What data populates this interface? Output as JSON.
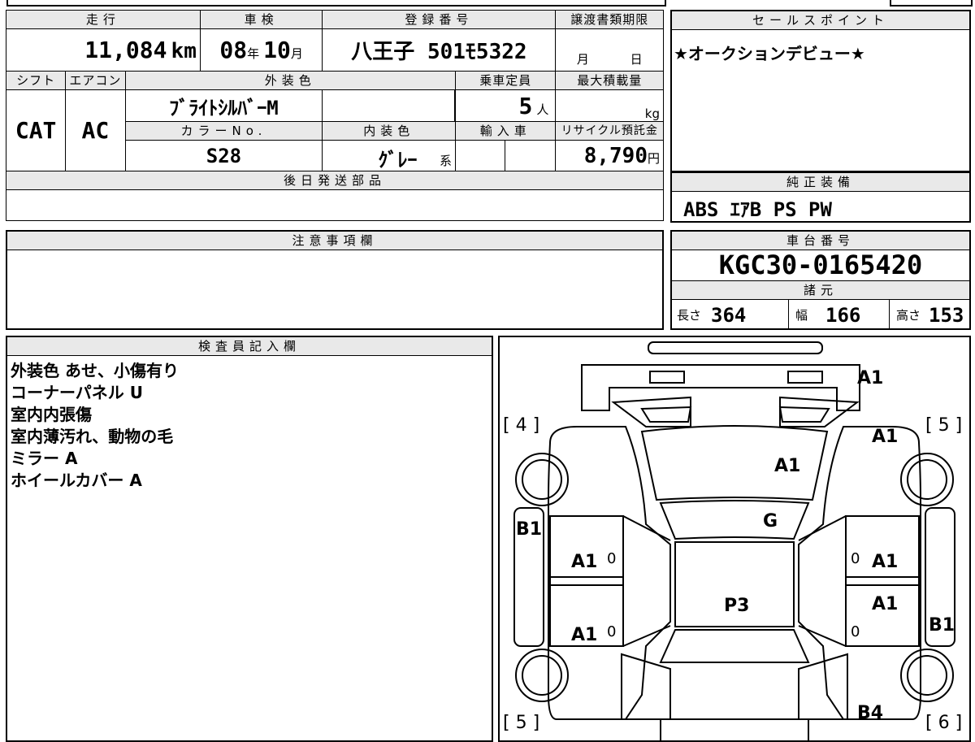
{
  "headers": {
    "mileage": "走行",
    "inspection": "車検",
    "registration": "登録番号",
    "transfer_deadline": "譲渡書類期限",
    "shift": "シフト",
    "aircon": "エアコン",
    "exterior_color": "外装色",
    "capacity": "乗車定員",
    "max_load": "最大積載量",
    "color_no": "カラーNo.",
    "interior_color": "内装色",
    "import_car": "輸入車",
    "recycle_fee": "リサイクル預託金",
    "later_parts": "後日発送部品",
    "sales_points": "セールスポイント",
    "genuine_equipment": "純正装備",
    "caution": "注意事項欄",
    "chassis_number": "車台番号",
    "specs": "諸元",
    "inspector": "検査員記入欄"
  },
  "vehicle": {
    "mileage_value": "11,084",
    "mileage_unit": "km",
    "inspection_year": "08",
    "year_unit": "年",
    "inspection_month": "10",
    "month_unit": "月",
    "registration_number": "八王子 501ﾓ5322",
    "deadline_month_unit": "月",
    "deadline_day_unit": "日",
    "shift": "CAT",
    "aircon": "AC",
    "exterior_color": "ﾌﾞﾗｲﾄｼﾙﾊﾞｰM",
    "capacity_value": "5",
    "capacity_unit": "人",
    "max_load_unit": "kg",
    "color_no": "S28",
    "interior_color": "ｸﾞﾚｰ",
    "interior_suffix": "系",
    "recycle_value": "8,790",
    "recycle_unit": "円",
    "sales_point": "★オークションデビュー★",
    "equipment": "ABS ｴｱB PS PW",
    "chassis_number": "KGC30-0165420",
    "length_label": "長さ",
    "length_value": "364",
    "width_label": "幅",
    "width_value": "166",
    "height_label": "高さ",
    "height_value": "153"
  },
  "inspector_notes": [
    "外装色 あせ、小傷有り",
    "コーナーパネル U",
    "室内内張傷",
    "室内薄汚れ、動物の毛",
    "ミラー A",
    "ホイールカバー A"
  ],
  "diagram": {
    "tire_front_left": "[ 4 ]",
    "tire_front_right": "[ 5 ]",
    "tire_rear_left": "[ 5 ]",
    "tire_rear_right": "[ 6 ]",
    "marks": {
      "front_bumper": "A1",
      "front_right_fender": "A1",
      "hood": "A1",
      "windshield": "G",
      "left_side": "B1",
      "front_left_door": "A1",
      "front_right_door": "A1",
      "roof": "P3",
      "rear_right_door": "A1",
      "rear_left_door": "A1",
      "right_side": "B1",
      "rear_right_corner": "B4",
      "zero_mark": "0"
    }
  }
}
